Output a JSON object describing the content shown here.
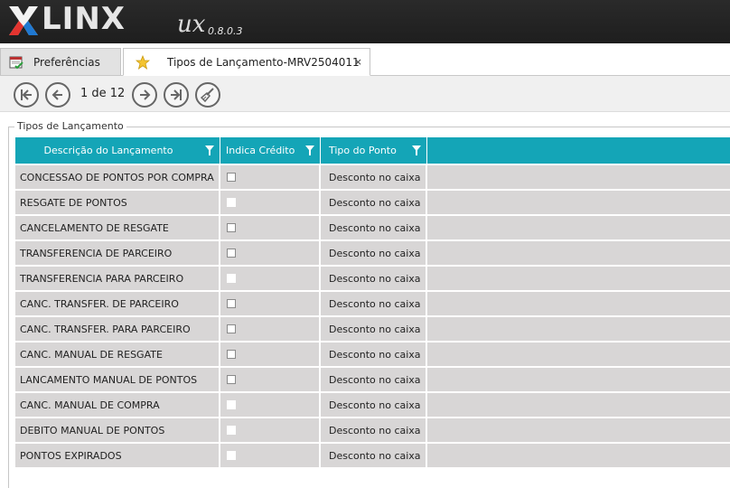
{
  "app": {
    "brand": "LINX",
    "brand_suffix": "ux",
    "version": "0.8.0.3"
  },
  "tabs": [
    {
      "label": "Preferências",
      "icon": "calendar-check-icon",
      "active": false
    },
    {
      "label": "Tipos de Lançamento-MRV2504011",
      "icon": "star-icon",
      "active": true,
      "close": "×"
    }
  ],
  "pager": {
    "text": "1 de 12"
  },
  "group": {
    "title": "Tipos de Lançamento"
  },
  "grid": {
    "columns": [
      "Descrição do Lançamento",
      "Indica Crédito",
      "Tipo do Ponto"
    ],
    "rows": [
      {
        "descricao": "CONCESSAO DE PONTOS POR COMPRA",
        "credito": true,
        "tipo": "Desconto no caixa"
      },
      {
        "descricao": "RESGATE DE PONTOS",
        "credito": false,
        "tipo": "Desconto no caixa"
      },
      {
        "descricao": "CANCELAMENTO DE RESGATE",
        "credito": true,
        "tipo": "Desconto no caixa"
      },
      {
        "descricao": "TRANSFERENCIA DE PARCEIRO",
        "credito": true,
        "tipo": "Desconto no caixa"
      },
      {
        "descricao": "TRANSFERENCIA PARA PARCEIRO",
        "credito": false,
        "tipo": "Desconto no caixa"
      },
      {
        "descricao": "CANC. TRANSFER. DE PARCEIRO",
        "credito": true,
        "tipo": "Desconto no caixa"
      },
      {
        "descricao": "CANC. TRANSFER. PARA PARCEIRO",
        "credito": true,
        "tipo": "Desconto no caixa"
      },
      {
        "descricao": "CANC. MANUAL DE RESGATE",
        "credito": true,
        "tipo": "Desconto no caixa"
      },
      {
        "descricao": "LANCAMENTO MANUAL DE PONTOS",
        "credito": true,
        "tipo": "Desconto no caixa"
      },
      {
        "descricao": "CANC. MANUAL DE COMPRA",
        "credito": false,
        "tipo": "Desconto no caixa"
      },
      {
        "descricao": "DEBITO MANUAL DE PONTOS",
        "credito": false,
        "tipo": "Desconto no caixa"
      },
      {
        "descricao": "PONTOS EXPIRADOS",
        "credito": false,
        "tipo": "Desconto no caixa"
      }
    ]
  },
  "colors": {
    "header_bg": "#222222",
    "grid_header": "#14a5b7",
    "row_bg": "#d8d6d6",
    "logo_red": "#e3342f",
    "logo_blue": "#1f78d1"
  }
}
